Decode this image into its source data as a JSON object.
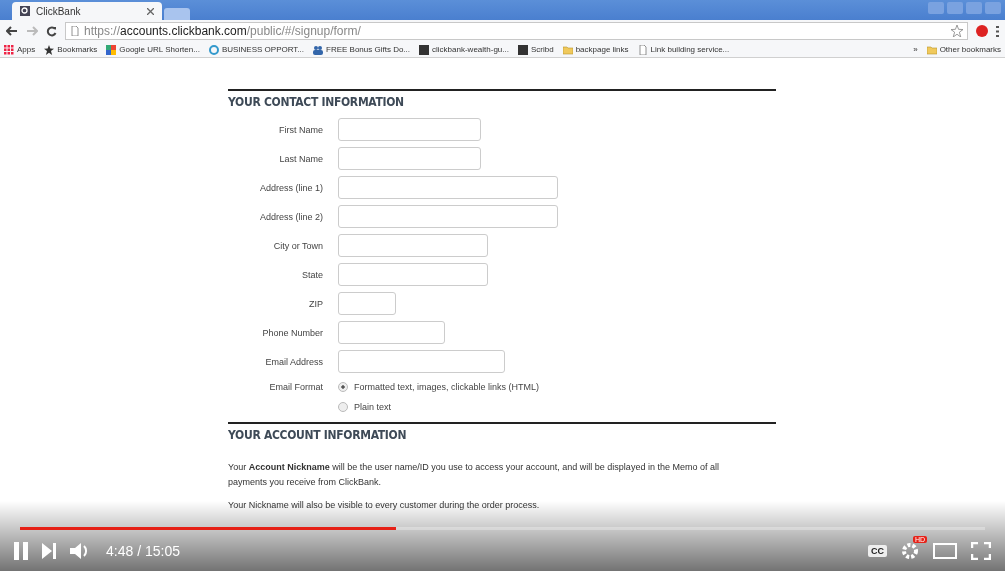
{
  "browser": {
    "tab": {
      "title": "ClickBank"
    },
    "url": {
      "scheme": "https://",
      "host": "accounts.clickbank.com",
      "path": "/public/#/signup/form/"
    },
    "bookmarks": [
      {
        "label": "Apps",
        "kind": "apps"
      },
      {
        "label": "Bookmarks",
        "kind": "star"
      },
      {
        "label": "Google URL Shorten...",
        "kind": "google"
      },
      {
        "label": "BUSINESS OPPORT...",
        "kind": "circle"
      },
      {
        "label": "FREE Bonus Gifts Do...",
        "kind": "people"
      },
      {
        "label": "clickbank-wealth-gu...",
        "kind": "letter"
      },
      {
        "label": "Scribd",
        "kind": "letter"
      },
      {
        "label": "backpage links",
        "kind": "folder"
      },
      {
        "label": "Link building service...",
        "kind": "page"
      }
    ],
    "more": "»",
    "other": {
      "label": "Other bookmarks",
      "kind": "folder"
    }
  },
  "sections": [
    {
      "title": "YOUR CONTACT INFORMATION",
      "fields": [
        {
          "label": "First Name",
          "kind": "text"
        },
        {
          "label": "Last Name",
          "kind": "text"
        },
        {
          "label": "Address (line 1)",
          "kind": "text"
        },
        {
          "label": "Address (line 2)",
          "kind": "text"
        },
        {
          "label": "City or Town",
          "kind": "text"
        },
        {
          "label": "State",
          "kind": "text"
        },
        {
          "label": "ZIP",
          "kind": "text"
        },
        {
          "label": "Phone Number",
          "kind": "text"
        },
        {
          "label": "Email Address",
          "kind": "text"
        },
        {
          "label": "Email Format",
          "kind": "radio",
          "options": [
            {
              "label": "Formatted text, images, clickable links (HTML)",
              "selected": true
            },
            {
              "label": "Plain text",
              "selected": false
            }
          ]
        }
      ]
    },
    {
      "title": "YOUR ACCOUNT INFORMATION",
      "paragraphs": [
        "Your **Account Nickname** will be the user name/ID you use to access your account, and will be displayed in the Memo of all payments you receive from ClickBank.",
        "Your Nickname will also be visible to every customer during the order process."
      ]
    }
  ],
  "player": {
    "progress": {
      "level": 0.39
    },
    "time": "4:48 / 15:05",
    "hd": "HD",
    "cc": "CC"
  }
}
